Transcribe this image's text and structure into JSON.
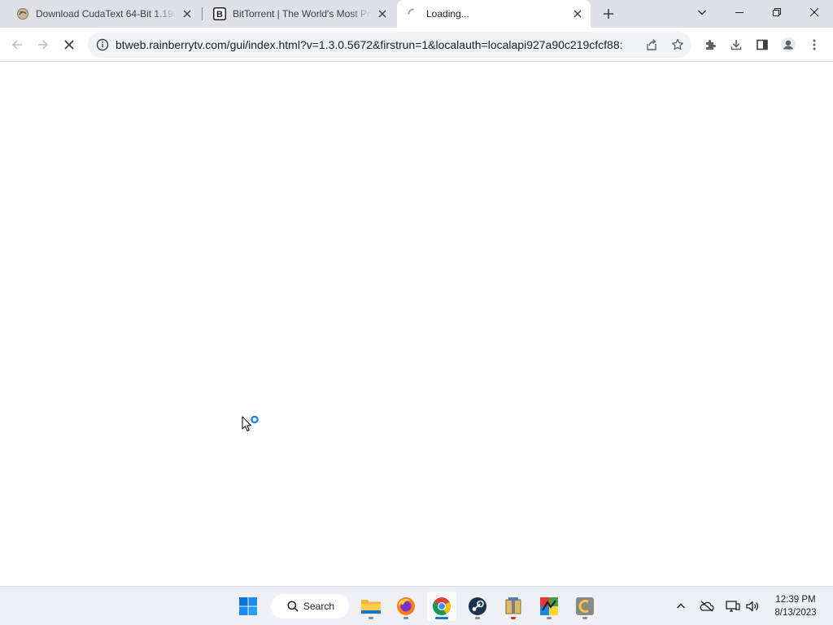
{
  "tabs": [
    {
      "title": "Download CudaText 64-Bit 1.196",
      "favicon": "cudatext-favicon-icon",
      "active": false
    },
    {
      "title": "BitTorrent | The World's Most Popular",
      "favicon": "bittorrent-favicon-icon",
      "active": false
    },
    {
      "title": "Loading...",
      "favicon": "loading-spinner-icon",
      "active": true
    }
  ],
  "toolbar": {
    "url": "btweb.rainberrytv.com/gui/index.html?v=1.3.0.5672&firstrun=1&localauth=localapi927a90c219cfcf88:"
  },
  "taskbar": {
    "search_label": "Search",
    "apps": [
      "start-icon",
      "file-explorer-icon",
      "firefox-icon",
      "chrome-icon",
      "steam-icon",
      "archive-manager-icon",
      "avg-icon",
      "cudatext-icon"
    ],
    "time": "12:39 PM",
    "date": "8/13/2023"
  },
  "colors": {
    "tabstrip_bg": "#dee1e6",
    "active_tab_bg": "#ffffff",
    "omnibox_bg": "#f1f3f4",
    "taskbar_bg": "#eef0f5",
    "accent": "#1a73e8"
  }
}
